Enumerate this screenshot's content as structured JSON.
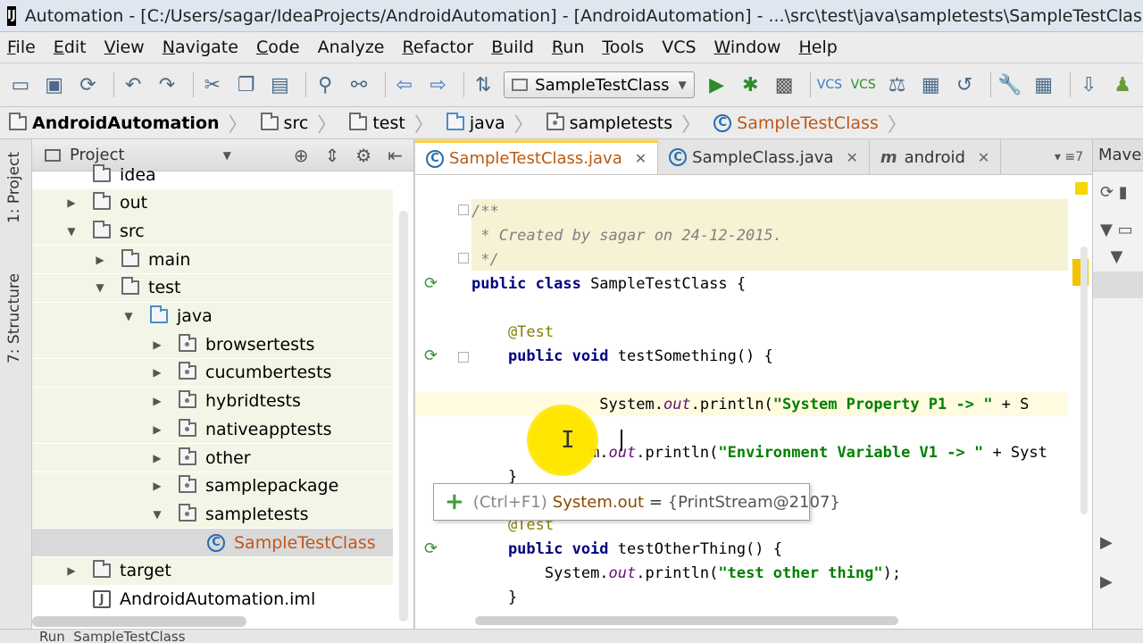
{
  "window": {
    "title": "Automation - [C:/Users/sagar/IdeaProjects/AndroidAutomation] - [AndroidAutomation] - ...\\src\\test\\java\\sampletests\\SampleTestClass.java - IntelliJ"
  },
  "menu": [
    {
      "u": "F",
      "rest": "ile"
    },
    {
      "u": "E",
      "rest": "dit"
    },
    {
      "u": "V",
      "rest": "iew"
    },
    {
      "u": "N",
      "rest": "avigate"
    },
    {
      "u": "C",
      "rest": "ode"
    },
    {
      "u": "",
      "rest": "Analyze"
    },
    {
      "u": "R",
      "rest": "efactor"
    },
    {
      "u": "B",
      "rest": "uild"
    },
    {
      "u": "R",
      "rest": "un"
    },
    {
      "u": "T",
      "rest": "ools"
    },
    {
      "u": "",
      "rest": "VCS"
    },
    {
      "u": "W",
      "rest": "indow"
    },
    {
      "u": "H",
      "rest": "elp"
    }
  ],
  "toolbar": {
    "run_config": "SampleTestClass",
    "icons": [
      "open-folder-icon",
      "save-icon",
      "sync-icon",
      "undo-icon",
      "redo-icon",
      "cut-icon",
      "copy-icon",
      "paste-icon",
      "find-icon",
      "replace-icon",
      "back-icon",
      "forward-icon",
      "build-icon",
      "run-icon",
      "debug-icon",
      "coverage-icon",
      "vcs-update-icon",
      "vcs-commit-icon",
      "vcs-compare-icon",
      "vcs-history-icon",
      "revert-icon",
      "settings-icon",
      "project-structure-icon",
      "sdk-manager-icon",
      "android-icon"
    ]
  },
  "breadcrumbs": [
    "AndroidAutomation",
    "src",
    "test",
    "java",
    "sampletests",
    "SampleTestClass"
  ],
  "side_tabs": {
    "project": "1: Project",
    "structure": "7: Structure"
  },
  "project_panel": {
    "header": "Project",
    "tree": [
      {
        "label": "idea",
        "depth": 1,
        "arrow": "none",
        "icon": "folder"
      },
      {
        "label": "out",
        "depth": 1,
        "arrow": "collapsed",
        "icon": "folder"
      },
      {
        "label": "src",
        "depth": 1,
        "arrow": "expanded",
        "icon": "folder"
      },
      {
        "label": "main",
        "depth": 2,
        "arrow": "collapsed",
        "icon": "folder"
      },
      {
        "label": "test",
        "depth": 2,
        "arrow": "expanded",
        "icon": "folder"
      },
      {
        "label": "java",
        "depth": 3,
        "arrow": "expanded",
        "icon": "src"
      },
      {
        "label": "browsertests",
        "depth": 4,
        "arrow": "collapsed",
        "icon": "pkg"
      },
      {
        "label": "cucumbertests",
        "depth": 4,
        "arrow": "collapsed",
        "icon": "pkg"
      },
      {
        "label": "hybridtests",
        "depth": 4,
        "arrow": "collapsed",
        "icon": "pkg"
      },
      {
        "label": "nativeapptests",
        "depth": 4,
        "arrow": "collapsed",
        "icon": "pkg"
      },
      {
        "label": "other",
        "depth": 4,
        "arrow": "collapsed",
        "icon": "pkg"
      },
      {
        "label": "samplepackage",
        "depth": 4,
        "arrow": "collapsed",
        "icon": "pkg"
      },
      {
        "label": "sampletests",
        "depth": 4,
        "arrow": "expanded",
        "icon": "pkg"
      },
      {
        "label": "SampleTestClass",
        "depth": 5,
        "arrow": "none",
        "icon": "class"
      },
      {
        "label": "target",
        "depth": 1,
        "arrow": "collapsed",
        "icon": "folder"
      },
      {
        "label": "AndroidAutomation.iml",
        "depth": 1,
        "arrow": "none",
        "icon": "iml"
      }
    ]
  },
  "editor": {
    "tabs": [
      {
        "label": "SampleTestClass.java",
        "icon": "C",
        "active": true
      },
      {
        "label": "SampleClass.java",
        "icon": "C",
        "active": false
      },
      {
        "label": "android",
        "icon": "m",
        "active": false
      }
    ],
    "tabs_more": "▾ ≡7",
    "code": [
      {
        "kind": "comment",
        "text": "/**"
      },
      {
        "kind": "comment",
        "text": " * Created by sagar on 24-12-2015."
      },
      {
        "kind": "comment",
        "text": " */"
      },
      {
        "kind": "classdecl",
        "kw": "public class",
        "text": " SampleTestClass {"
      },
      {
        "kind": "blank",
        "text": ""
      },
      {
        "kind": "annotation",
        "text": "    @Test"
      },
      {
        "kind": "method",
        "kw": "    public void",
        "text": " testSomething() {"
      },
      {
        "kind": "blank",
        "text": ""
      },
      {
        "kind": "print",
        "indent": "              ",
        "obj": "System.",
        "fld": "out",
        "call": ".println(",
        "str": "\"System Property P1 -> \"",
        "tail": " + S"
      },
      {
        "kind": "blank",
        "text": ""
      },
      {
        "kind": "print",
        "indent": "        ",
        "obj": "System.",
        "fld": "out",
        "call": ".println(",
        "str": "\"Environment Variable V1 -> \"",
        "tail": " + Syst"
      },
      {
        "kind": "brace",
        "text": "    }"
      },
      {
        "kind": "blank",
        "text": ""
      },
      {
        "kind": "annotation",
        "text": "    @Test"
      },
      {
        "kind": "method",
        "kw": "    public void",
        "text": " testOtherThing() {"
      },
      {
        "kind": "print",
        "indent": "        ",
        "obj": "System.",
        "fld": "out",
        "call": ".println(",
        "str": "\"test other thing\"",
        "tail": ");"
      },
      {
        "kind": "brace",
        "text": "    }"
      }
    ],
    "tooltip": {
      "hint": "(Ctrl+F1)",
      "expr": "System.out",
      "eq": " = ",
      "value": "{PrintStream@2107}"
    }
  },
  "right_panel": {
    "header": "Maven"
  },
  "bottom": {
    "text": "Run  SampleTestClass"
  },
  "colors": {
    "comment_bg": "#f6f2d4",
    "keyword": "#000080",
    "string": "#008000",
    "field": "#660e7a",
    "class_name": "#c0571a",
    "active_tab_accent": "#ffcf3f"
  }
}
